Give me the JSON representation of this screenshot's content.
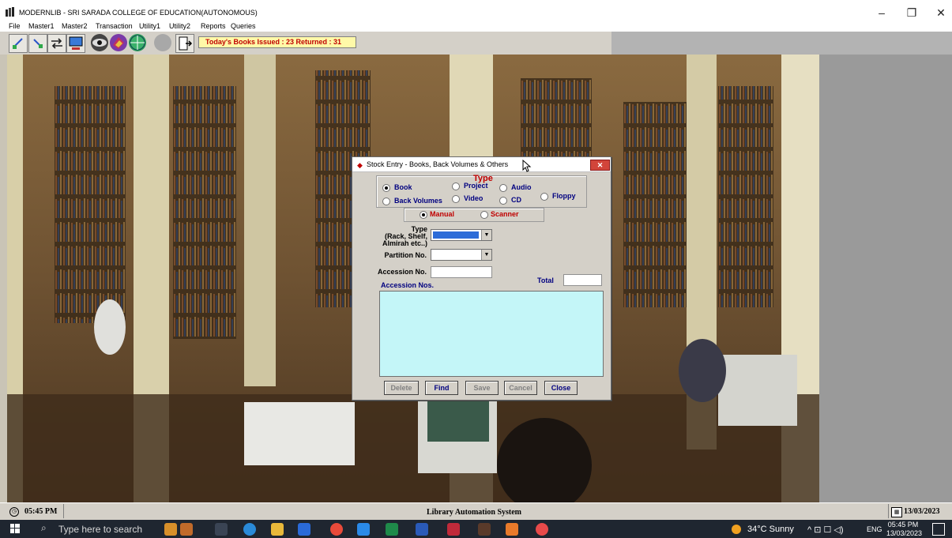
{
  "window": {
    "title": "MODERNLIB - SRI SARADA COLLEGE OF EDUCATION(AUTONOMOUS)",
    "controls": {
      "minimize": "–",
      "maximize": "❐",
      "close": "✕"
    }
  },
  "menu": {
    "items": [
      "File",
      "Master1",
      "Master2",
      "Transaction",
      "Utility1",
      "Utility2",
      "Reports",
      "Queries"
    ]
  },
  "toolbar": {
    "today_text": "Today's Books Issued : 23 Returned : 31"
  },
  "dialog": {
    "title": "Stock Entry - Books, Back Volumes & Others",
    "close_label": "✕",
    "type_group_label": "Type",
    "type_options": {
      "book": "Book",
      "back_volumes": "Back Volumes",
      "project": "Project",
      "video": "Video",
      "audio": "Audio",
      "cd": "CD",
      "floppy": "Floppy"
    },
    "selected_type": "Book",
    "entry_mode": {
      "manual": "Manual",
      "scanner": "Scanner",
      "selected": "Manual"
    },
    "fields": {
      "location_type_label": "Type\n(Rack, Shelf,\nAlmirah etc..)",
      "location_type_line1": "Type",
      "location_type_line2": "(Rack, Shelf,",
      "location_type_line3": "Almirah etc..)",
      "partition_label": "Partition No.",
      "accession_label": "Accession No.",
      "total_label": "Total",
      "accession_list_label": "Accession Nos."
    },
    "buttons": {
      "delete": "Delete",
      "find": "Find",
      "save": "Save",
      "cancel": "Cancel",
      "close": "Close"
    }
  },
  "statusbar": {
    "time": "05:45 PM",
    "system_name": "Library Automation System",
    "date": "13/03/2023"
  },
  "taskbar": {
    "search_placeholder": "Type here to search",
    "weather": "34°C  Sunny",
    "language": "ENG",
    "clock_time": "05:45 PM",
    "clock_date": "13/03/2023"
  },
  "colors": {
    "dialog_bg": "#d4d0c8",
    "list_bg": "#c4f6f8",
    "accent_red": "#c00000",
    "label_blue": "#000080",
    "today_bg": "#fff9a8"
  }
}
